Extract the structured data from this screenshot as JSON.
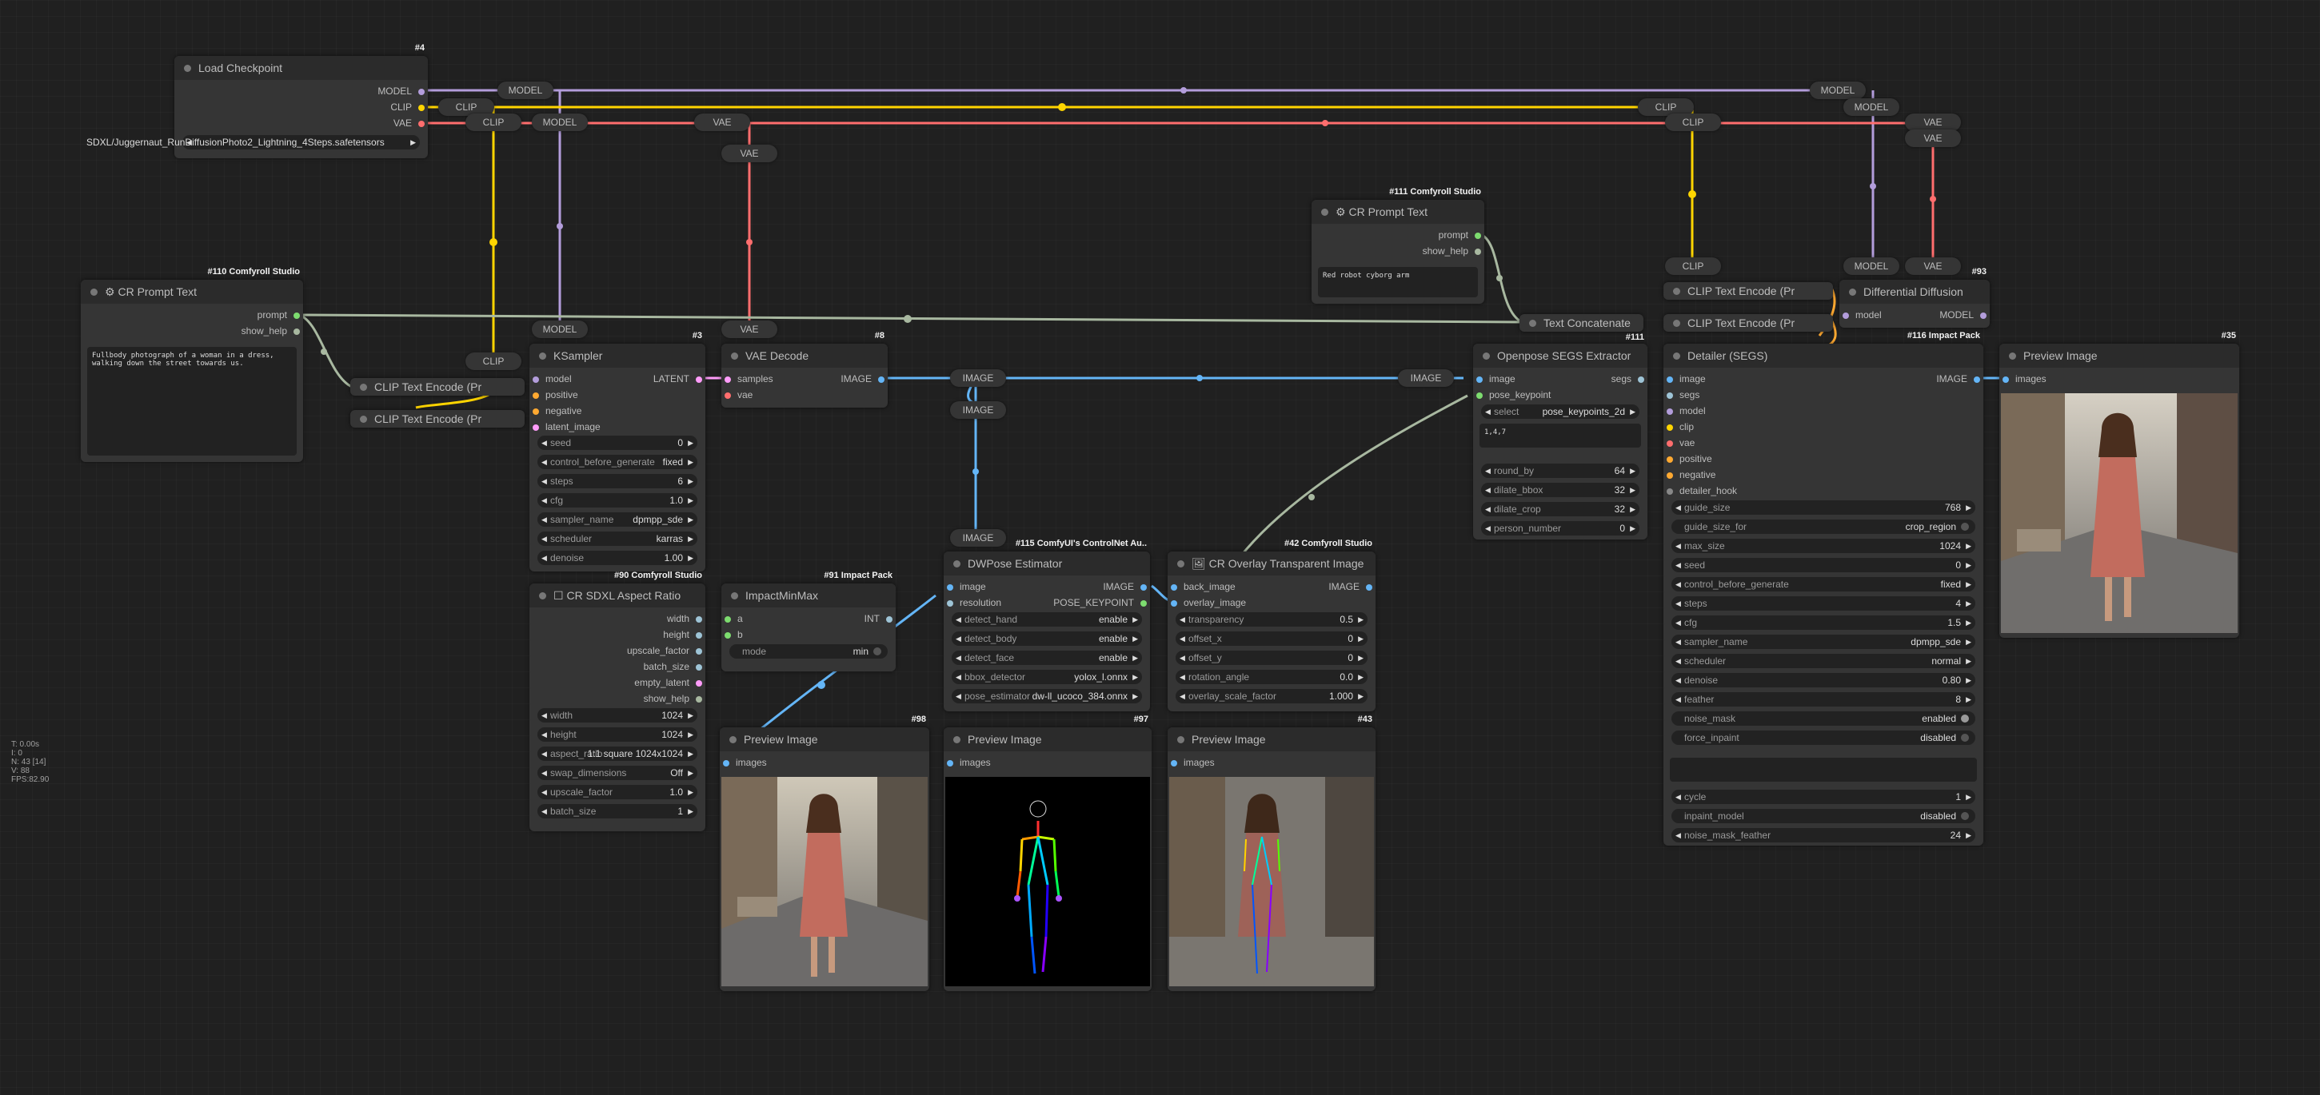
{
  "hud": {
    "t": "T: 0.00s",
    "i": "I: 0",
    "n": "N: 43 [14]",
    "v": "V: 88",
    "fps": "FPS:82.90"
  },
  "nodes": {
    "load_checkpoint": {
      "badge": "#4",
      "title": "Load Checkpoint",
      "out_model": "MODEL",
      "out_clip": "CLIP",
      "out_vae": "VAE",
      "ckpt_value": "SDXL/Juggernaut_RunDiffusionPhoto2_Lightning_4Steps.safetensors"
    },
    "cr_prompt_110": {
      "badge": "#110 Comfyroll Studio",
      "title": "CR Prompt Text",
      "out_prompt": "prompt",
      "out_show_help": "show_help",
      "text": "Fullbody photograph of a woman in a dress, walking down the street towards us."
    },
    "cr_prompt_111": {
      "badge": "#111 Comfyroll Studio",
      "title": "CR Prompt Text",
      "out_prompt": "prompt",
      "out_show_help": "show_help",
      "text": "Red robot cyborg arm"
    },
    "clip_text_encode_1": {
      "title": "CLIP Text Encode (Pr"
    },
    "clip_text_encode_2": {
      "title": "CLIP Text Encode (Pr"
    },
    "ksampler": {
      "badge": "#3",
      "title": "KSampler",
      "in": [
        "model",
        "positive",
        "negative",
        "latent_image"
      ],
      "out": "LATENT",
      "widgets": [
        {
          "label": "seed",
          "value": "0"
        },
        {
          "label": "control_before_generate",
          "value": "fixed"
        },
        {
          "label": "steps",
          "value": "6"
        },
        {
          "label": "cfg",
          "value": "1.0"
        },
        {
          "label": "sampler_name",
          "value": "dpmpp_sde"
        },
        {
          "label": "scheduler",
          "value": "karras"
        },
        {
          "label": "denoise",
          "value": "1.00"
        }
      ]
    },
    "vae_decode": {
      "badge": "#8",
      "title": "VAE Decode",
      "in": [
        "samples",
        "vae"
      ],
      "out": "IMAGE"
    },
    "cr_sdxl_aspect": {
      "badge": "#90 Comfyroll Studio",
      "title": "CR SDXL Aspect Ratio",
      "outs": [
        "width",
        "height",
        "upscale_factor",
        "batch_size",
        "empty_latent",
        "show_help"
      ],
      "widgets": [
        {
          "label": "width",
          "value": "1024"
        },
        {
          "label": "height",
          "value": "1024"
        },
        {
          "label": "aspect_ratio",
          "value": "1:1 square 1024x1024"
        },
        {
          "label": "swap_dimensions",
          "value": "Off"
        },
        {
          "label": "upscale_factor",
          "value": "1.0"
        },
        {
          "label": "batch_size",
          "value": "1"
        }
      ]
    },
    "impact_minmax": {
      "badge": "#91 Impact Pack",
      "title": "ImpactMinMax",
      "in": [
        "a",
        "b"
      ],
      "out": "INT",
      "mode_label": "mode",
      "mode_value": "min"
    },
    "dwpose": {
      "badge": "#115 ComfyUI's ControlNet Au..",
      "title": "DWPose Estimator",
      "in": [
        "image",
        "resolution"
      ],
      "outs": [
        "IMAGE",
        "POSE_KEYPOINT"
      ],
      "widgets": [
        {
          "label": "detect_hand",
          "value": "enable"
        },
        {
          "label": "detect_body",
          "value": "enable"
        },
        {
          "label": "detect_face",
          "value": "enable"
        },
        {
          "label": "bbox_detector",
          "value": "yolox_l.onnx"
        },
        {
          "label": "pose_estimator",
          "value": "dw-ll_ucoco_384.onnx"
        }
      ]
    },
    "cr_overlay": {
      "badge": "#42 Comfyroll Studio",
      "title": "CR Overlay Transparent Image",
      "in": [
        "back_image",
        "overlay_image"
      ],
      "out": "IMAGE",
      "widgets": [
        {
          "label": "transparency",
          "value": "0.5"
        },
        {
          "label": "offset_x",
          "value": "0"
        },
        {
          "label": "offset_y",
          "value": "0"
        },
        {
          "label": "rotation_angle",
          "value": "0.0"
        },
        {
          "label": "overlay_scale_factor",
          "value": "1.000"
        }
      ]
    },
    "openpose_segs": {
      "badge": "#111",
      "title": "Openpose SEGS Extractor",
      "in": [
        "image",
        "pose_keypoint"
      ],
      "out": "segs",
      "selector_label": "select",
      "selector_value": "pose_keypoints_2d",
      "selector_text": "1,4,7",
      "widgets": [
        {
          "label": "round_by",
          "value": "64"
        },
        {
          "label": "dilate_bbox",
          "value": "32"
        },
        {
          "label": "dilate_crop",
          "value": "32"
        },
        {
          "label": "person_number",
          "value": "0"
        }
      ]
    },
    "text_concat": {
      "title": "Text Concatenate"
    },
    "clip_enc_3": {
      "title": "CLIP Text Encode (Pr"
    },
    "clip_enc_4": {
      "title": "CLIP Text Encode (Pr"
    },
    "diff_diffusion": {
      "badge": "#93",
      "title": "Differential Diffusion",
      "in": "model",
      "out": "MODEL"
    },
    "detailer": {
      "badge": "#116 Impact Pack",
      "title": "Detailer (SEGS)",
      "in": [
        "image",
        "segs",
        "model",
        "clip",
        "vae",
        "positive",
        "negative",
        "detailer_hook"
      ],
      "out": "IMAGE",
      "widgets": [
        {
          "label": "guide_size",
          "value": "768"
        },
        {
          "label": "guide_size_for",
          "value": "crop_region"
        },
        {
          "label": "max_size",
          "value": "1024"
        },
        {
          "label": "seed",
          "value": "0"
        },
        {
          "label": "control_before_generate",
          "value": "fixed"
        },
        {
          "label": "steps",
          "value": "4"
        },
        {
          "label": "cfg",
          "value": "1.5"
        },
        {
          "label": "sampler_name",
          "value": "dpmpp_sde"
        },
        {
          "label": "scheduler",
          "value": "normal"
        },
        {
          "label": "denoise",
          "value": "0.80"
        },
        {
          "label": "feather",
          "value": "8"
        },
        {
          "label": "noise_mask",
          "value": "enabled"
        },
        {
          "label": "force_inpaint",
          "value": "disabled"
        }
      ],
      "widgets2": [
        {
          "label": "cycle",
          "value": "1"
        },
        {
          "label": "inpaint_model",
          "value": "disabled"
        },
        {
          "label": "noise_mask_feather",
          "value": "24"
        }
      ]
    },
    "preview_98": {
      "badge": "#98",
      "title": "Preview Image",
      "in": "images"
    },
    "preview_97": {
      "badge": "#97",
      "title": "Preview Image",
      "in": "images"
    },
    "preview_43": {
      "badge": "#43",
      "title": "Preview Image",
      "in": "images"
    },
    "preview_35": {
      "badge": "#35",
      "title": "Preview Image",
      "in": "images"
    }
  },
  "reroutes": {
    "model": "MODEL",
    "clip": "CLIP",
    "vae": "VAE",
    "image": "IMAGE"
  },
  "colors": {
    "model": "#b39ddb",
    "clip": "#ffd500",
    "vae": "#ff6e6e",
    "image": "#64b5f6",
    "latent": "#ff9cf9",
    "string": "#a8b8a0",
    "cond": "#ffa931",
    "int": "#9ec4d6",
    "green_socket": "#7ddc6f"
  }
}
